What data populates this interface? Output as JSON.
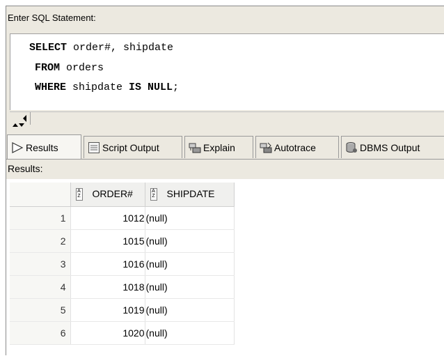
{
  "editor": {
    "label": "Enter SQL Statement:",
    "lines": [
      {
        "kw": "SELECT",
        "rest": " order#, shipdate"
      },
      {
        "kw": "FROM",
        "rest": " orders"
      },
      {
        "kw": "WHERE",
        "rest": " shipdate ",
        "kw2": "IS NULL",
        "rest2": ";"
      }
    ]
  },
  "tabs": [
    {
      "label": "Results",
      "icon": "play-triangle-icon",
      "active": true
    },
    {
      "label": "Script Output",
      "icon": "script-output-icon"
    },
    {
      "label": "Explain",
      "icon": "explain-icon"
    },
    {
      "label": "Autotrace",
      "icon": "autotrace-icon"
    },
    {
      "label": "DBMS Output",
      "icon": "dbms-output-icon"
    }
  ],
  "results": {
    "label": "Results:",
    "columns": [
      "ORDER#",
      "SHIPDATE"
    ],
    "rows": [
      {
        "num": "1",
        "order": "1012",
        "shipdate": "(null)"
      },
      {
        "num": "2",
        "order": "1015",
        "shipdate": "(null)"
      },
      {
        "num": "3",
        "order": "1016",
        "shipdate": "(null)"
      },
      {
        "num": "4",
        "order": "1018",
        "shipdate": "(null)"
      },
      {
        "num": "5",
        "order": "1019",
        "shipdate": "(null)"
      },
      {
        "num": "6",
        "order": "1020",
        "shipdate": "(null)"
      }
    ]
  },
  "colors": {
    "accent": "#4a7ebb",
    "chrome": "#ece9e0"
  }
}
